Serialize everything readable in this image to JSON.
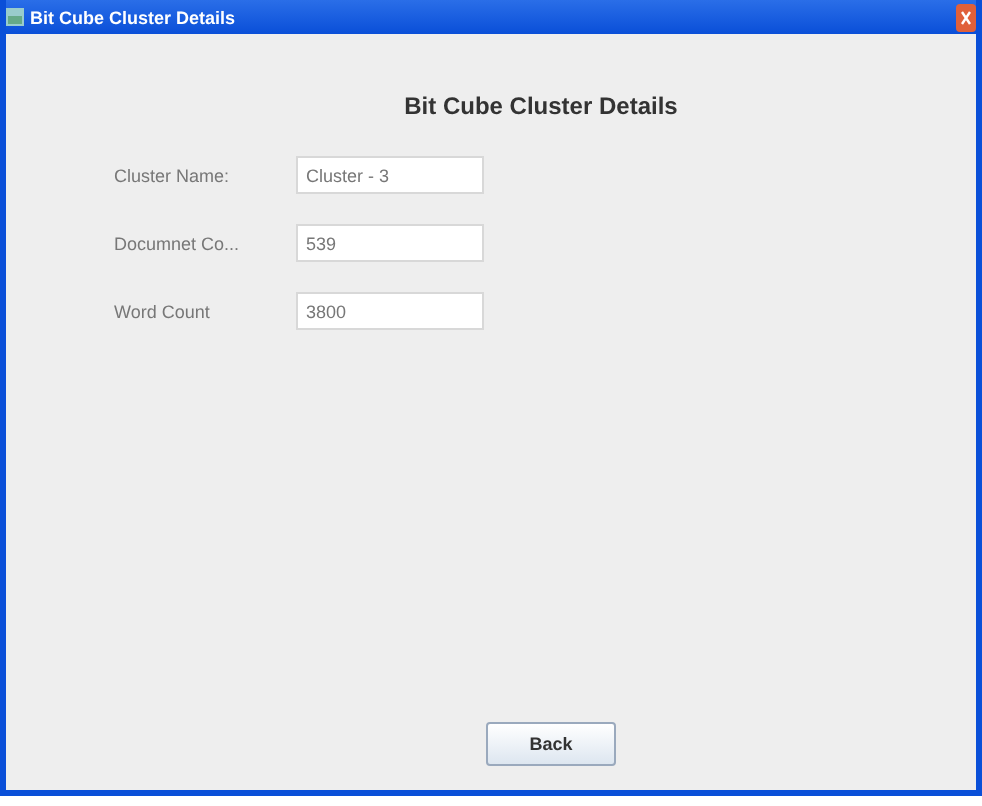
{
  "window": {
    "title": "Bit Cube Cluster Details"
  },
  "heading": "Bit Cube Cluster Details",
  "fields": [
    {
      "label": "Cluster Name:",
      "value": "Cluster - 3"
    },
    {
      "label": "Documnet Co...",
      "value": "539"
    },
    {
      "label": "Word Count",
      "value": "3800"
    }
  ],
  "buttons": [
    "Back"
  ]
}
